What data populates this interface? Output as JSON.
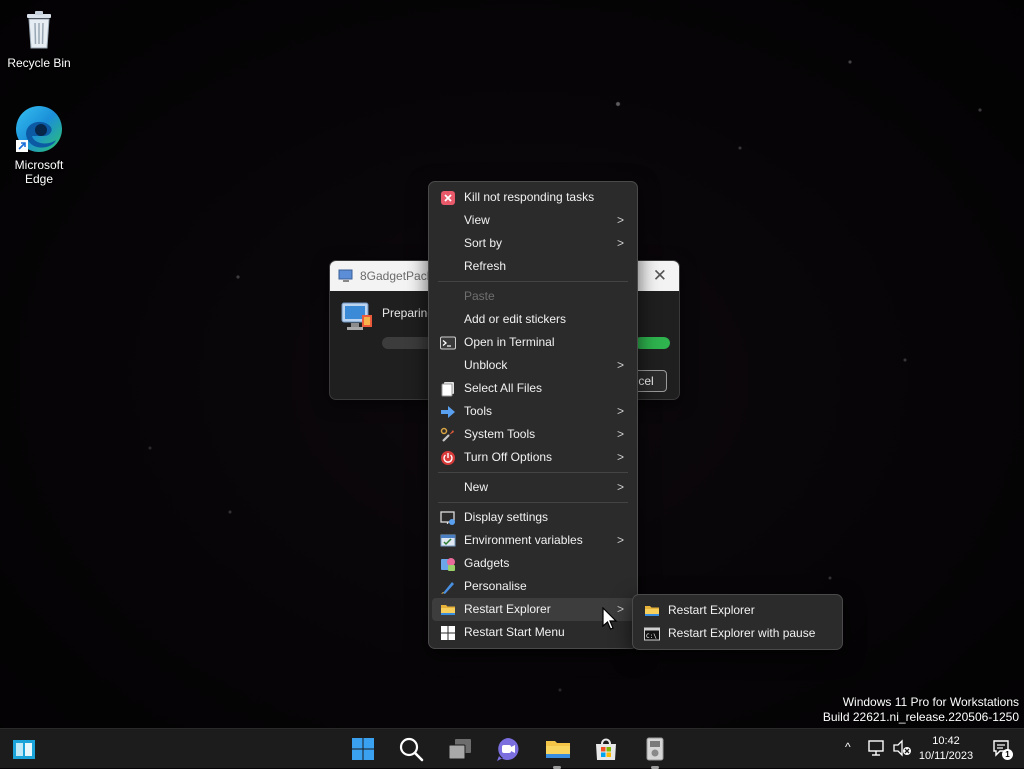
{
  "desktop": {
    "icons": [
      {
        "label": "Recycle Bin",
        "icon": "recycle-bin-icon"
      },
      {
        "label": "Microsoft Edge",
        "icon": "edge-icon"
      }
    ],
    "watermark": {
      "line1": "Windows 11 Pro for Workstations",
      "line2": "Build 22621.ni_release.220506-1250"
    }
  },
  "dialog": {
    "title": "8GadgetPack",
    "status": "Preparing",
    "cancel_label": "Cancel",
    "close_glyph": "✕",
    "progress_fraction": 0.12
  },
  "context_menu": {
    "items": [
      {
        "label": "Kill not responding tasks",
        "icon": "kill-tasks-icon"
      },
      {
        "label": "View",
        "icon": "",
        "submenu": true
      },
      {
        "label": "Sort by",
        "icon": "",
        "submenu": true
      },
      {
        "label": "Refresh",
        "icon": ""
      },
      {
        "label": "Paste",
        "icon": "",
        "disabled": true
      },
      {
        "label": "Add or edit stickers",
        "icon": ""
      },
      {
        "label": "Open in Terminal",
        "icon": "terminal-icon"
      },
      {
        "label": "Unblock",
        "icon": "",
        "submenu": true
      },
      {
        "label": "Select All Files",
        "icon": "select-files-icon"
      },
      {
        "label": "Tools",
        "icon": "tools-arrow-icon",
        "submenu": true
      },
      {
        "label": "System Tools",
        "icon": "system-tools-icon",
        "submenu": true
      },
      {
        "label": "Turn Off Options",
        "icon": "power-icon",
        "submenu": true
      },
      {
        "label": "New",
        "icon": "",
        "submenu": true
      },
      {
        "label": "Display settings",
        "icon": "display-settings-icon"
      },
      {
        "label": "Environment variables",
        "icon": "environment-variables-icon",
        "submenu": true
      },
      {
        "label": "Gadgets",
        "icon": "gadgets-icon"
      },
      {
        "label": "Personalise",
        "icon": "personalise-brush-icon"
      },
      {
        "label": "Restart Explorer",
        "icon": "folder-icon",
        "submenu": true,
        "active": true
      },
      {
        "label": "Restart Start Menu",
        "icon": "windows-logo-icon"
      }
    ],
    "submenu_arrow": ">"
  },
  "submenu": {
    "items": [
      {
        "label": "Restart Explorer",
        "icon": "folder-icon"
      },
      {
        "label": "Restart Explorer with pause",
        "icon": "command-prompt-icon"
      }
    ]
  },
  "taskbar": {
    "apps": [
      {
        "name": "widgets-icon"
      },
      {
        "name": "start-button-icon"
      },
      {
        "name": "search-icon"
      },
      {
        "name": "task-view-icon"
      },
      {
        "name": "teams-chat-icon"
      },
      {
        "name": "file-explorer-icon"
      },
      {
        "name": "microsoft-store-icon"
      },
      {
        "name": "8gadgetpack-installer-icon"
      }
    ],
    "tray_chevron": "^",
    "clock_time": "10:42",
    "clock_date": "10/11/2023",
    "notification_count": "1"
  },
  "colors": {
    "menu_bg": "#2b2b2b",
    "accent_green": "#2eb34e",
    "folder_yellow": "#f2c447"
  }
}
